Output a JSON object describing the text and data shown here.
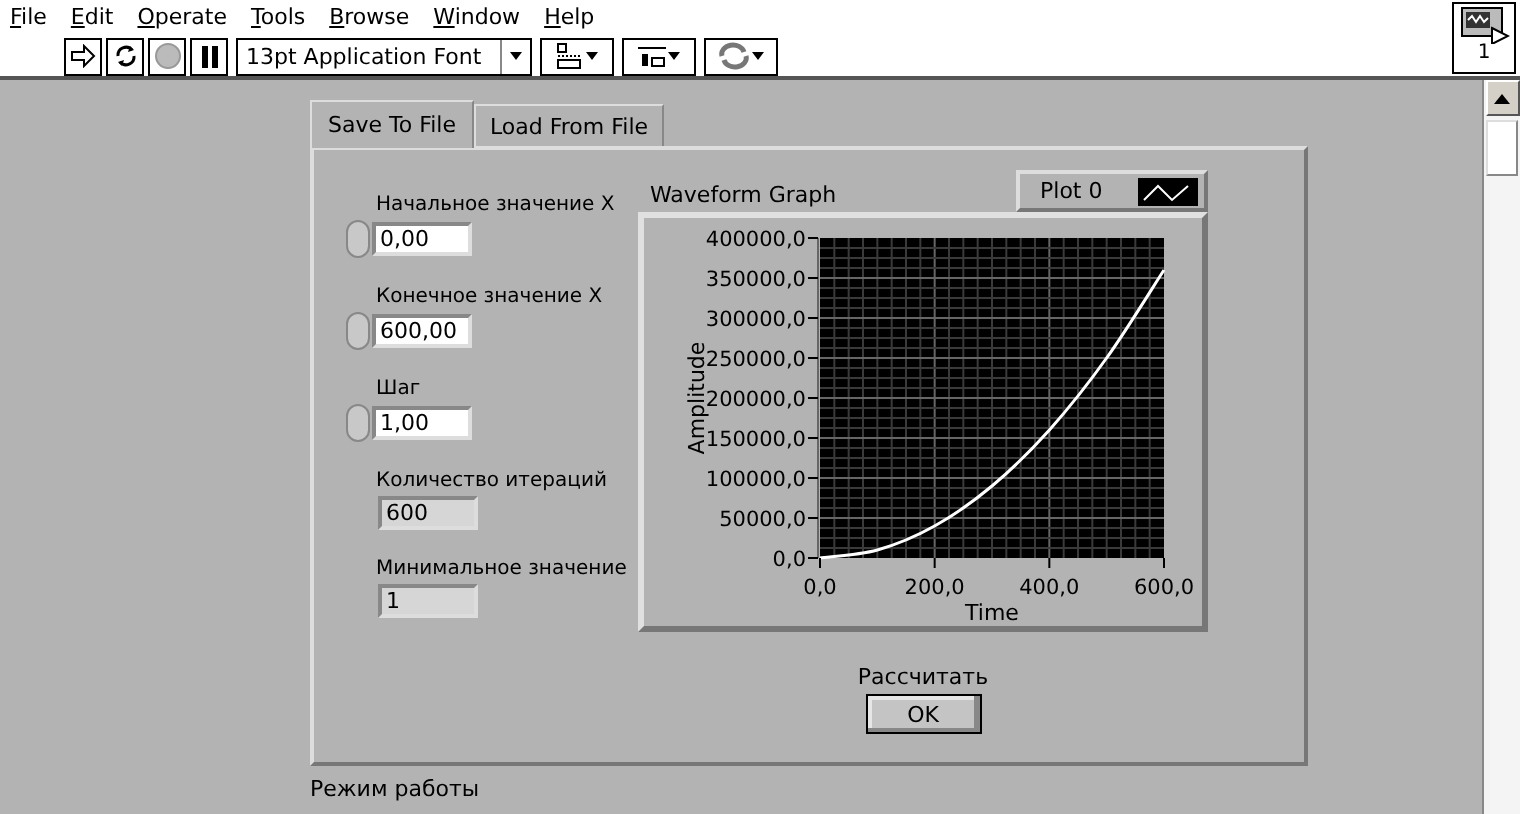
{
  "menu": [
    {
      "label": "File"
    },
    {
      "label": "Edit"
    },
    {
      "label": "Operate"
    },
    {
      "label": "Tools"
    },
    {
      "label": "Browse"
    },
    {
      "label": "Window"
    },
    {
      "label": "Help"
    }
  ],
  "toolbar": {
    "buttons": [
      {
        "kind": "run",
        "disabled": false
      },
      {
        "kind": "run_continuously",
        "disabled": false
      },
      {
        "kind": "abort",
        "disabled": true
      },
      {
        "kind": "pause",
        "disabled": false
      }
    ],
    "font_selector": "13pt Application Font",
    "dropdowns": [
      {
        "kind": "align"
      },
      {
        "kind": "distribute"
      },
      {
        "kind": "reorder"
      }
    ]
  },
  "vi_icon": {
    "label": "1"
  },
  "tabs": [
    {
      "label": "Save To File",
      "selected": true
    },
    {
      "label": "Load From File",
      "selected": false
    }
  ],
  "controls": [
    {
      "kind": "numeric",
      "label": "Начальное значение X",
      "value": "0,00"
    },
    {
      "kind": "numeric",
      "label": "Конечное значение X",
      "value": "600,00"
    },
    {
      "kind": "numeric",
      "label": "Шаг",
      "value": "1,00"
    },
    {
      "kind": "indicator",
      "label": "Количество итераций",
      "value": "600"
    },
    {
      "kind": "indicator",
      "label": "Минимальное значение",
      "value": "1"
    }
  ],
  "graph": {
    "title": "Waveform Graph",
    "chart_data": {
      "type": "line",
      "xlabel": "Time",
      "ylabel": "Amplitude",
      "grid": true,
      "x": [
        0,
        100,
        200,
        300,
        400,
        500,
        600
      ],
      "series": [
        {
          "name": "Plot 0",
          "color": "#ffffff",
          "values": [
            0,
            10000,
            40000,
            90000,
            160000,
            250000,
            360000
          ]
        }
      ],
      "xlim": [
        0,
        600
      ],
      "ylim": [
        0,
        400000
      ],
      "xticks": [
        {
          "value": 0,
          "label": "0,0"
        },
        {
          "value": 200,
          "label": "200,0"
        },
        {
          "value": 400,
          "label": "400,0"
        },
        {
          "value": 600,
          "label": "600,0"
        }
      ],
      "yticks": [
        {
          "value": 0,
          "label": "0,0"
        },
        {
          "value": 50000,
          "label": "50000,0"
        },
        {
          "value": 100000,
          "label": "100000,0"
        },
        {
          "value": 150000,
          "label": "150000,0"
        },
        {
          "value": 200000,
          "label": "200000,0"
        },
        {
          "value": 250000,
          "label": "250000,0"
        },
        {
          "value": 300000,
          "label": "300000,0"
        },
        {
          "value": 350000,
          "label": "350000,0"
        },
        {
          "value": 400000,
          "label": "400000,0"
        }
      ]
    }
  },
  "button": {
    "label": "Рассчитать",
    "text": "OK"
  },
  "footer_label": "Режим работы"
}
